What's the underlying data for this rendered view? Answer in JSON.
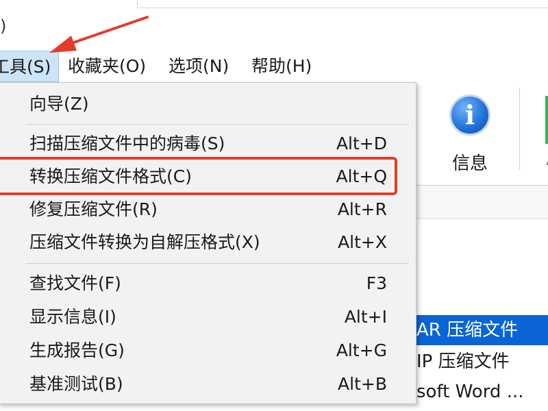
{
  "window": {
    "title_fragment": ")"
  },
  "menubar": {
    "items": [
      {
        "label": "工具(S)"
      },
      {
        "label": "收藏夹(O)"
      },
      {
        "label": "选项(N)"
      },
      {
        "label": "帮助(H)"
      }
    ]
  },
  "toolbar": {
    "info_label": "信息",
    "stub_letter": "/"
  },
  "filelist": {
    "rows": [
      {
        "text": "AR 压缩文件"
      },
      {
        "text": "IP 压缩文件"
      },
      {
        "text": "soft Word ..."
      }
    ]
  },
  "dropdown": {
    "items": [
      {
        "label": "向导(Z)",
        "shortcut": ""
      },
      {
        "label": "扫描压缩文件中的病毒(S)",
        "shortcut": "Alt+D"
      },
      {
        "label": "转换压缩文件格式(C)",
        "shortcut": "Alt+Q"
      },
      {
        "label": "修复压缩文件(R)",
        "shortcut": "Alt+R"
      },
      {
        "label": "压缩文件转换为自解压格式(X)",
        "shortcut": "Alt+X"
      },
      {
        "label": "查找文件(F)",
        "shortcut": "F3"
      },
      {
        "label": "显示信息(I)",
        "shortcut": "Alt+I"
      },
      {
        "label": "生成报告(G)",
        "shortcut": "Alt+G"
      },
      {
        "label": "基准测试(B)",
        "shortcut": "Alt+B"
      }
    ]
  },
  "colors": {
    "annotation_red": "#e23c2c",
    "menu_active_bg": "#cce4f7",
    "selection_blue": "#0a64d6",
    "dropdown_bg": "#f2f2f2"
  }
}
